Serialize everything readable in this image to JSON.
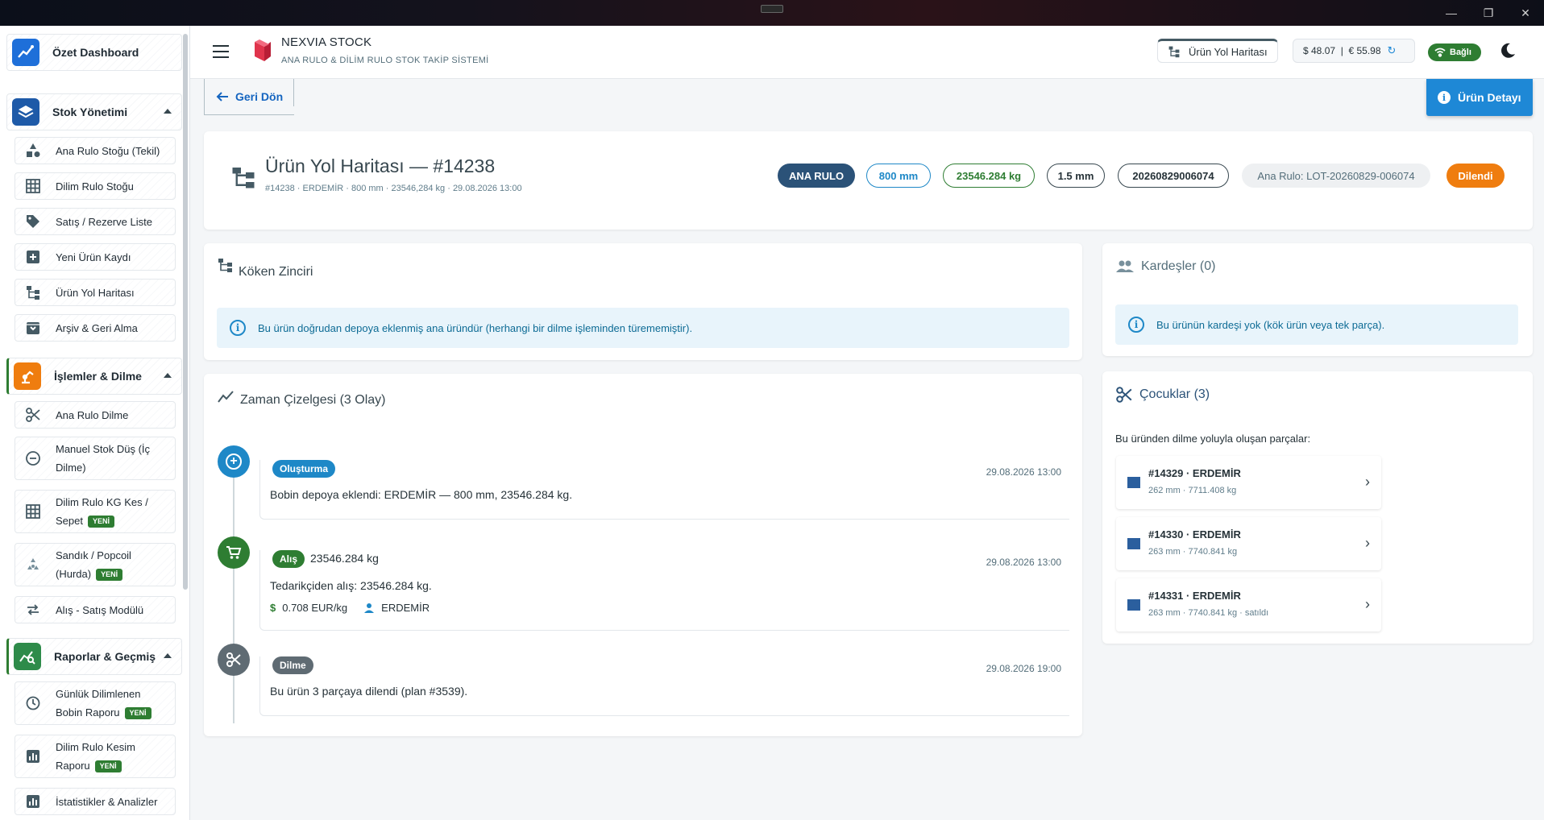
{
  "window": {
    "minimize": "—",
    "maximize": "❐",
    "close": "✕"
  },
  "sidebar": {
    "dashboard": "Özet Dashboard",
    "sections": [
      {
        "label": "Stok Yönetimi"
      },
      {
        "label": "İşlemler & Dilme"
      },
      {
        "label": "Raporlar & Geçmiş"
      }
    ],
    "stock_items": [
      "Ana Rulo Stoğu (Tekil)",
      "Dilim Rulo Stoğu",
      "Satış / Rezerve Liste",
      "Yeni Ürün Kaydı",
      "Ürün Yol Haritası",
      "Arşiv & Geri Alma"
    ],
    "ops_items": [
      "Ana Rulo Dilme",
      "Manuel Stok Düş (İç Dilme)",
      "Dilim Rulo KG Kes / Sepet",
      "Sandık / Popcoil (Hurda)",
      "Alış - Satış Modülü"
    ],
    "report_items": [
      "Günlük Dilimlenen Bobin Raporu",
      "Dilim Rulo Kesim Raporu",
      "İstatistikler & Analizler"
    ],
    "new_badge": "YENİ"
  },
  "header": {
    "title": "NEXVIA STOCK",
    "subtitle": "ANA RULO & DİLİM RULO STOK TAKİP SİSTEMİ",
    "route_chip": "Ürün Yol Haritası",
    "fx_text": "$ 48.07  |  € 55.98",
    "connection": "Bağlı"
  },
  "actions": {
    "back": "Geri Dön",
    "detail": "Ürün Detayı"
  },
  "product": {
    "title": "Ürün Yol Haritası — #14238",
    "subtitle": "#14238 · ERDEMİR · 800 mm · 23546,284 kg · 29.08.2026 13:00",
    "chips": {
      "type": "ANA RULO",
      "width": "800 mm",
      "weight": "23546.284 kg",
      "thickness": "1.5 mm",
      "code": "20260829006074",
      "lot": "Ana Rulo: LOT-20260829-006074",
      "status": "Dilendi"
    }
  },
  "origin": {
    "title": "Köken Zinciri",
    "info": "Bu ürün doğrudan depoya eklenmiş ana üründür (herhangi bir dilme işleminden türememiştir)."
  },
  "timeline": {
    "title": "Zaman Çizelgesi (3 Olay)",
    "events": [
      {
        "chip": "Oluşturma",
        "date": "29.08.2026 13:00",
        "text": "Bobin depoya eklendi: ERDEMİR — 800 mm, 23546.284 kg."
      },
      {
        "chip": "Alış",
        "amount": "23546.284 kg",
        "date": "29.08.2026 13:00",
        "text": "Tedarikçiden alış: 23546.284 kg.",
        "price": "0.708 EUR/kg",
        "supplier": "ERDEMİR"
      },
      {
        "chip": "Dilme",
        "date": "29.08.2026 19:00",
        "text": "Bu ürün 3 parçaya dilendi (plan #3539)."
      }
    ]
  },
  "siblings": {
    "title": "Kardeşler (0)",
    "info": "Bu ürünün kardeşi yok (kök ürün veya tek parça)."
  },
  "children": {
    "title": "Çocuklar (3)",
    "intro": "Bu üründen dilme yoluyla oluşan parçalar:",
    "items": [
      {
        "name": "#14329 · ERDEMİR",
        "detail": "262 mm · 7711.408 kg"
      },
      {
        "name": "#14330 · ERDEMİR",
        "detail": "263 mm · 7740.841 kg"
      },
      {
        "name": "#14331 · ERDEMİR",
        "detail": "263 mm · 7740.841 kg · satıldı"
      }
    ]
  },
  "colors": {
    "primary": "#1e88d6",
    "ana_rulo": "#2b5278",
    "status": "#ef7d0f",
    "success": "#2e7d32"
  }
}
